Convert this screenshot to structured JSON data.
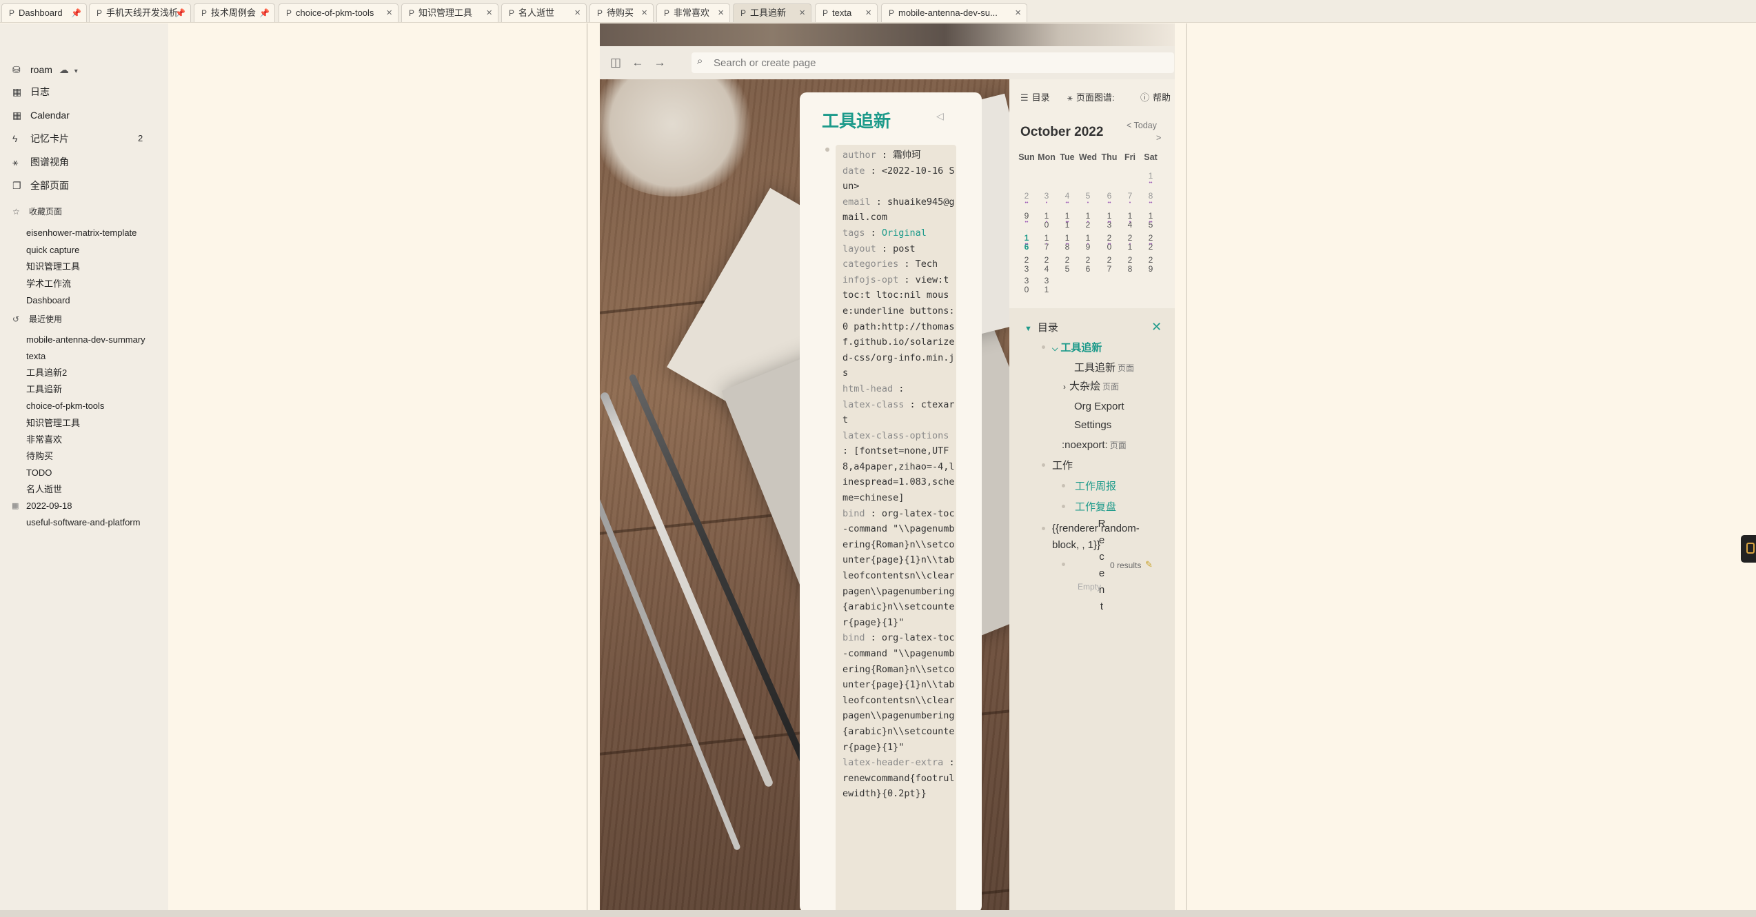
{
  "tabs": [
    {
      "icon": "P",
      "label": "Dashboard",
      "pinned": true,
      "active": false
    },
    {
      "icon": "P",
      "label": "手机天线开发浅析",
      "pinned": true,
      "active": false
    },
    {
      "icon": "P",
      "label": "技术周例会",
      "pinned": true,
      "active": false
    },
    {
      "icon": "P",
      "label": "choice-of-pkm-tools",
      "pinned": false,
      "active": false
    },
    {
      "icon": "P",
      "label": "知识管理工具",
      "pinned": false,
      "active": false
    },
    {
      "icon": "P",
      "label": "名人逝世",
      "pinned": false,
      "active": false
    },
    {
      "icon": "P",
      "label": "待购买",
      "pinned": false,
      "active": false
    },
    {
      "icon": "P",
      "label": "非常喜欢",
      "pinned": false,
      "active": false
    },
    {
      "icon": "P",
      "label": "工具追新",
      "pinned": false,
      "active": true
    },
    {
      "icon": "P",
      "label": "texta",
      "pinned": false,
      "active": false
    },
    {
      "icon": "P",
      "label": "mobile-antenna-dev-su...",
      "pinned": false,
      "active": false
    }
  ],
  "sidebar": {
    "graph": "roam",
    "nav": [
      {
        "icon": "calendar-icon",
        "label": "日志",
        "count": ""
      },
      {
        "icon": "calendar-icon",
        "label": "Calendar",
        "count": ""
      },
      {
        "icon": "flash-icon",
        "label": "记忆卡片",
        "count": "2"
      },
      {
        "icon": "graph-icon",
        "label": "图谱视角",
        "count": ""
      },
      {
        "icon": "pages-icon",
        "label": "全部页面",
        "count": ""
      }
    ],
    "favorites_title": "收藏页面",
    "favorites": [
      "eisenhower-matrix-template",
      "quick capture",
      "知识管理工具",
      "学术工作流",
      "Dashboard"
    ],
    "recent_title": "最近使用",
    "recent": [
      "mobile-antenna-dev-summary",
      "texta",
      "工具追新2",
      "工具追新",
      "choice-of-pkm-tools",
      "知识管理工具",
      "非常喜欢",
      "待购买",
      "TODO",
      "名人逝世",
      "2022-09-18",
      "useful-software-and-platform"
    ]
  },
  "search": {
    "placeholder": "Search or create page"
  },
  "page": {
    "title": "工具追新",
    "properties": [
      {
        "key": "author",
        "value": "霜帅珂"
      },
      {
        "key": "date",
        "value": "<2022-10-16 Sun>"
      },
      {
        "key": "email",
        "value": "shuaike945@gmail.com"
      },
      {
        "key": "tags",
        "value": "Original",
        "tag": true
      },
      {
        "key": "layout",
        "value": "post"
      },
      {
        "key": "categories",
        "value": "Tech"
      },
      {
        "key": "infojs-opt",
        "value": "view:t toc:t ltoc:nil mouse:underline buttons:0 path:http://thomasf.github.io/solarized-css/org-info.min.js"
      },
      {
        "key": "html-head",
        "value": ""
      },
      {
        "key": "latex-class",
        "value": "ctexart"
      },
      {
        "key": "latex-class-options",
        "value": "[fontset=none,UTF8,a4paper,zihao=-4,linespread=1.083,scheme=chinese]"
      },
      {
        "key": "bind",
        "value": "org-latex-toc-command \"\\\\pagenumbering{Roman}n\\\\setcounter{page}{1}n\\\\tableofcontentsn\\\\clearpagen\\\\pagenumbering{arabic}n\\\\setcounter{page}{1}\""
      },
      {
        "key": "bind",
        "value": "org-latex-toc-command \"\\\\pagenumbering{Roman}n\\\\setcounter{page}{1}n\\\\tableofcontentsn\\\\clearpagen\\\\pagenumbering{arabic}n\\\\setcounter{page}{1}\""
      },
      {
        "key": "latex-header-extra",
        "value": "renewcommand{footrulewidth}{0.2pt}}"
      }
    ]
  },
  "right_panel": {
    "tabs": {
      "toc": "目录",
      "graph": "页面图谱:",
      "help": "帮助"
    },
    "calendar": {
      "title": "October 2022",
      "today": "< Today",
      "next": ">",
      "weekdays": [
        "Sun",
        "Mon",
        "Tue",
        "Wed",
        "Thu",
        "Fri",
        "Sat"
      ],
      "weeks": [
        [
          "",
          "",
          "",
          "",
          "",
          "",
          "1"
        ],
        [
          "2",
          "3",
          "4",
          "5",
          "6",
          "7",
          "8"
        ],
        [
          "9",
          "1\n0",
          "1\n1",
          "1\n2",
          "1\n3",
          "1\n4",
          "1\n5"
        ],
        [
          "1\n6",
          "1\n7",
          "1\n8",
          "1\n9",
          "2\n0",
          "2\n1",
          "2\n2"
        ],
        [
          "2\n3",
          "2\n4",
          "2\n5",
          "2\n6",
          "2\n7",
          "2\n8",
          "2\n9"
        ],
        [
          "3\n0",
          "3\n1",
          "",
          "",
          "",
          "",
          ""
        ]
      ]
    },
    "toc": {
      "title": "目录",
      "root": "工具追新",
      "items": [
        {
          "text": "工具追新",
          "note": "页面"
        },
        {
          "text": "大杂烩",
          "note": "页面"
        },
        {
          "text": "Org Export Settings",
          "note": ""
        },
        {
          "text": ":noexport:",
          "note": "页面"
        }
      ],
      "work": "工作",
      "work_items": [
        "工作周报",
        "工作复盘"
      ],
      "renderer": "{{renderer random-block, , 1}}",
      "recent_vertical": "Recent",
      "results": "0 results",
      "empty": "Empty"
    }
  }
}
